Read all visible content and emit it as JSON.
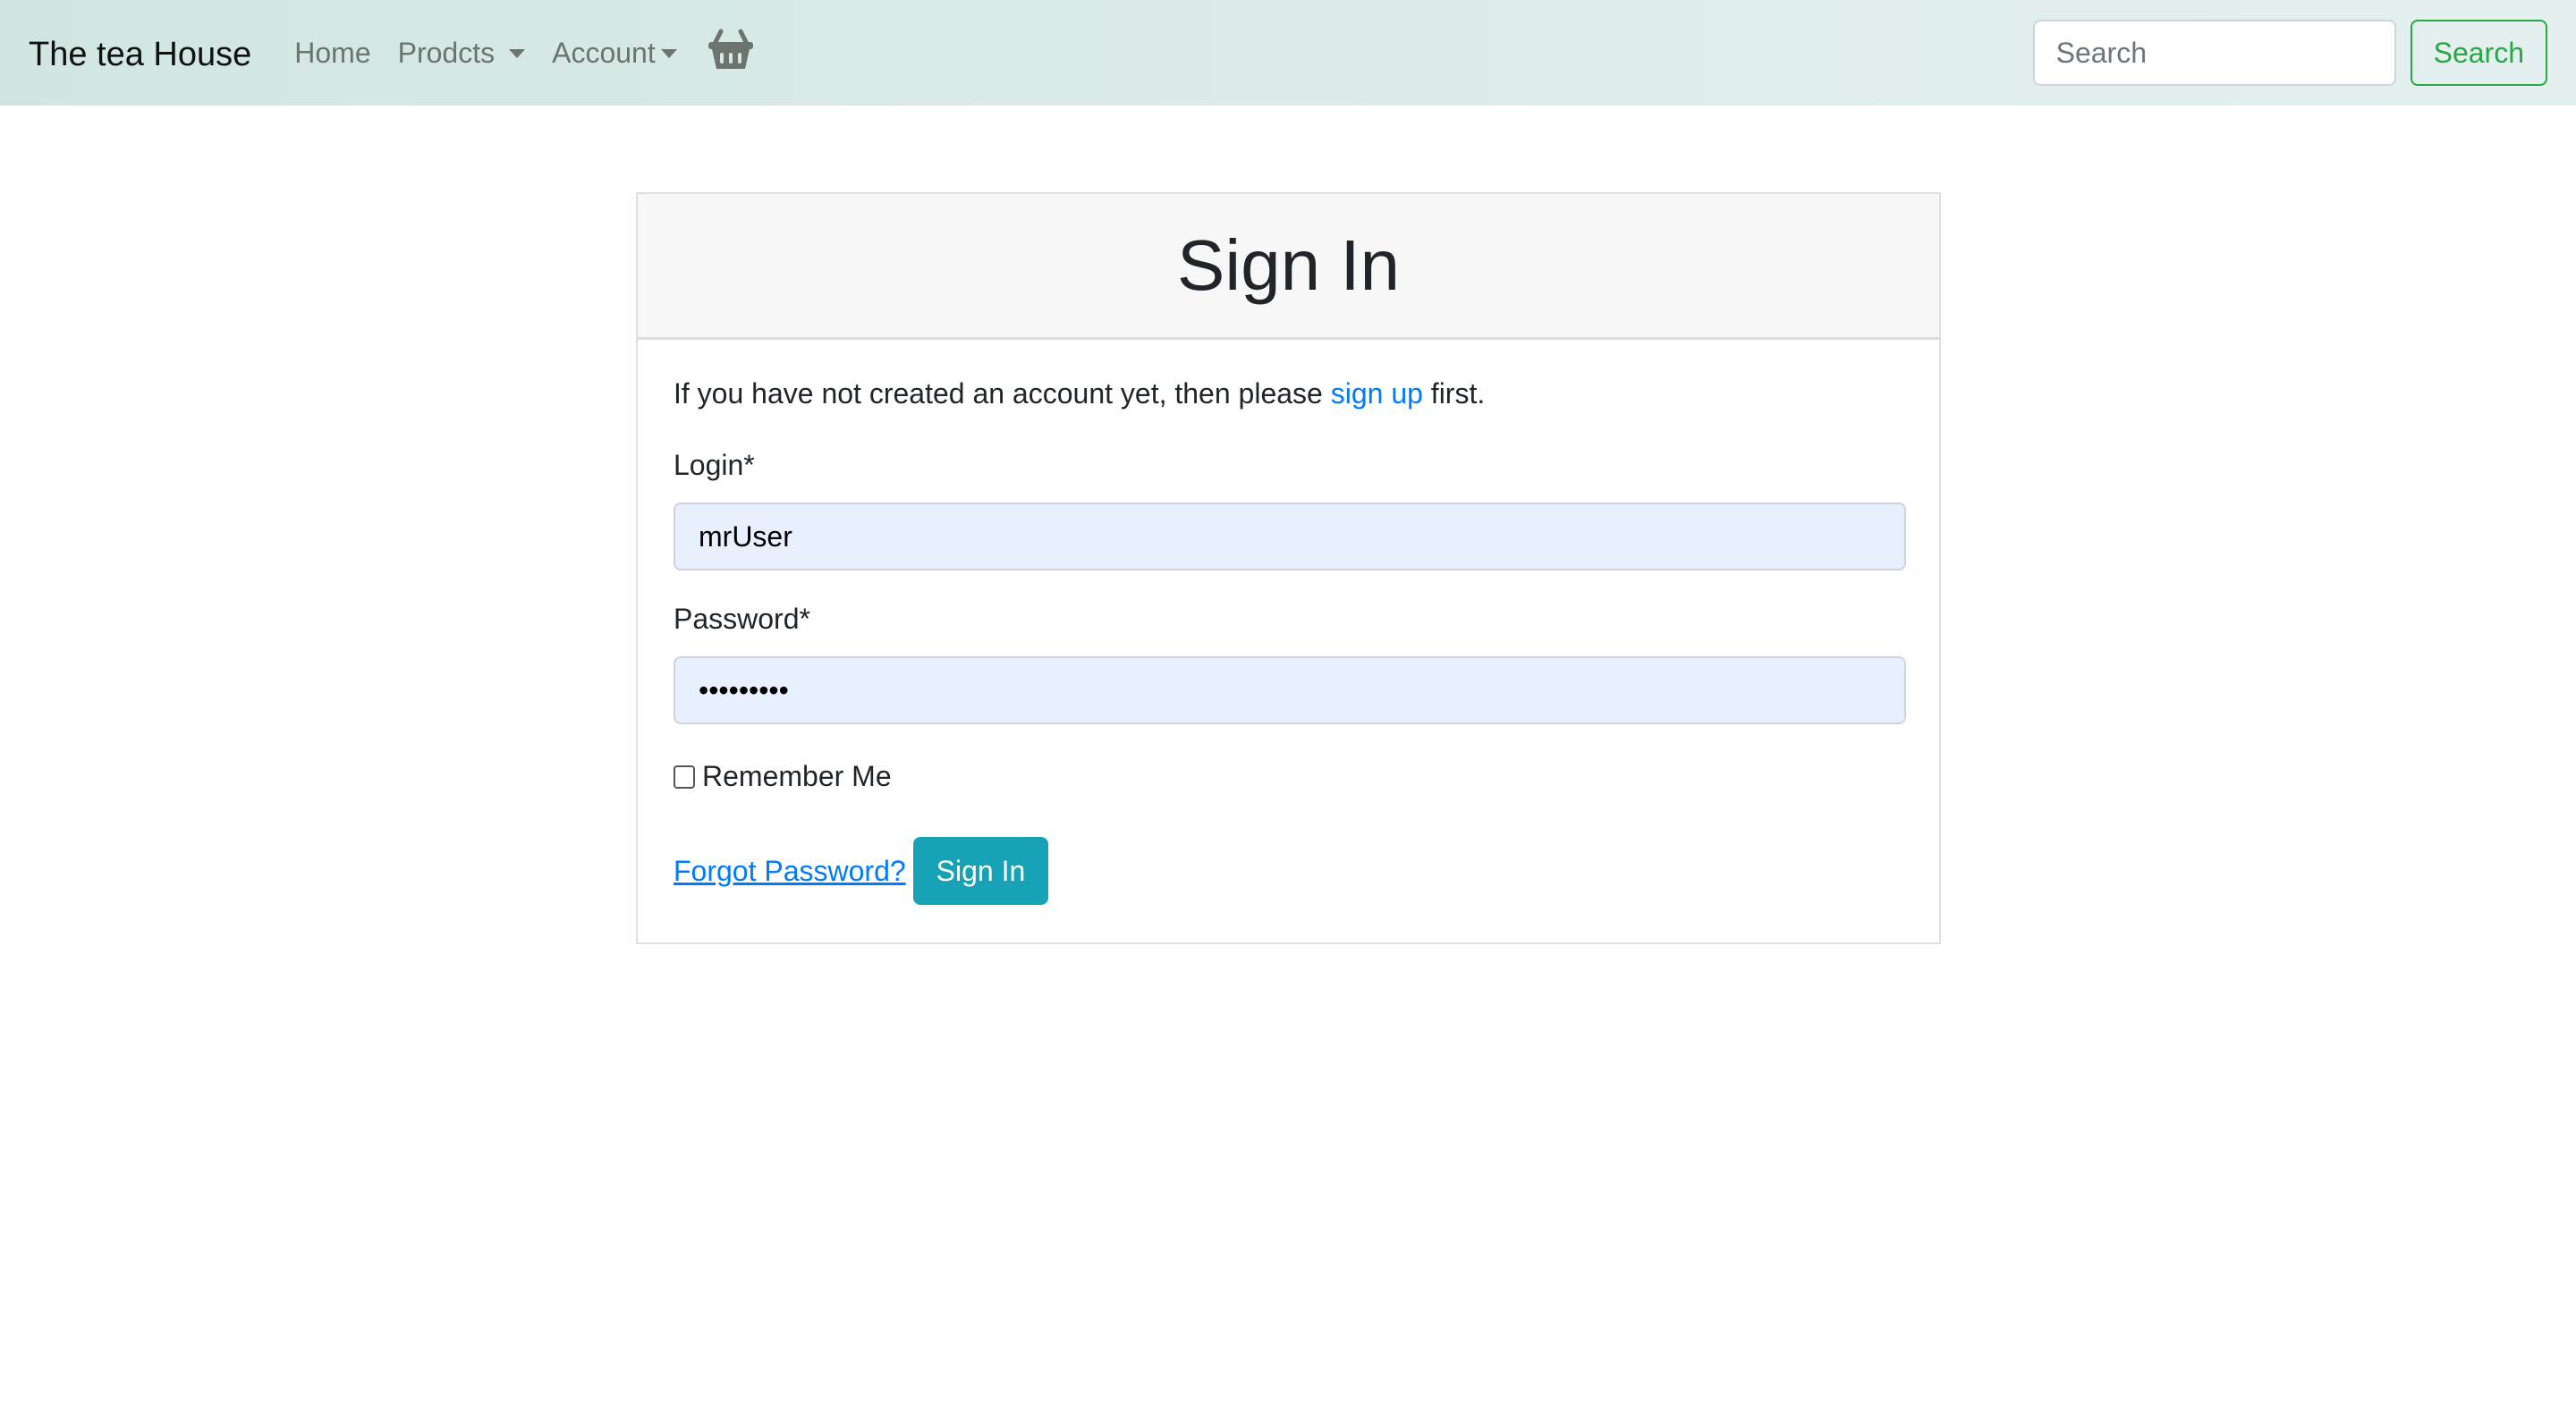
{
  "navbar": {
    "brand": "The tea House",
    "items": [
      {
        "label": "Home",
        "dropdown": false
      },
      {
        "label": "Prodcts",
        "dropdown": true
      },
      {
        "label": "Account",
        "dropdown": true
      }
    ],
    "cart_icon": "basket-icon",
    "search": {
      "placeholder": "Search",
      "value": "",
      "button_label": "Search"
    },
    "colors": {
      "search_button": "#28a745"
    }
  },
  "signin": {
    "title": "Sign In",
    "intro_before": "If you have not created an account yet, then please ",
    "intro_link": "sign up",
    "intro_after": " first.",
    "login_label": "Login*",
    "login_value": "mrUser",
    "password_label": "Password*",
    "password_value": "•••••••••",
    "remember_label": "Remember Me",
    "remember_checked": false,
    "forgot_label": "Forgot Password?",
    "submit_label": "Sign In",
    "colors": {
      "link": "#007bff",
      "submit": "#17a2b8",
      "autofill": "#e8f0fe"
    }
  }
}
